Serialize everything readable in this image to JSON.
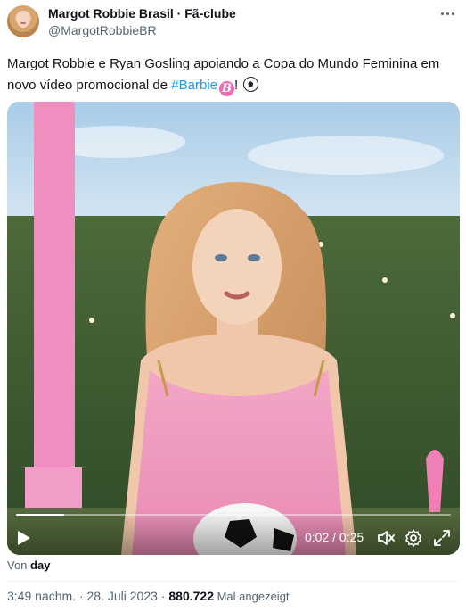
{
  "author": {
    "display_name": "Margot Robbie Brasil · Fã-clube",
    "handle": "@MargotRobbieBR",
    "avatar_icon": "profile-photo"
  },
  "tweet": {
    "text_before": "Margot Robbie e Ryan Gosling apoiando a Copa do Mundo Feminina em novo vídeo promocional de ",
    "hashtag": "#Barbie",
    "text_after": "! ",
    "barbie_emoji_letter": "B",
    "ball_emoji": "soccer-ball-icon"
  },
  "video": {
    "current_time": "0:02",
    "separator": " / ",
    "duration": "0:25",
    "progress_fraction": 0.11,
    "icons": [
      "play-icon",
      "mute-icon",
      "settings-icon",
      "fullscreen-icon"
    ]
  },
  "source": {
    "prefix": "Von ",
    "name": "day"
  },
  "meta": {
    "time": "3:49 nachm.",
    "dot": " · ",
    "date": "28. Juli 2023",
    "dot2": " · ",
    "views": "880.722",
    "views_label": " Mal angezeigt"
  },
  "colors": {
    "accent": "#1d9bf0",
    "text": "#0f1419",
    "muted": "#536471",
    "barbie_pink": "#f06ab4"
  }
}
